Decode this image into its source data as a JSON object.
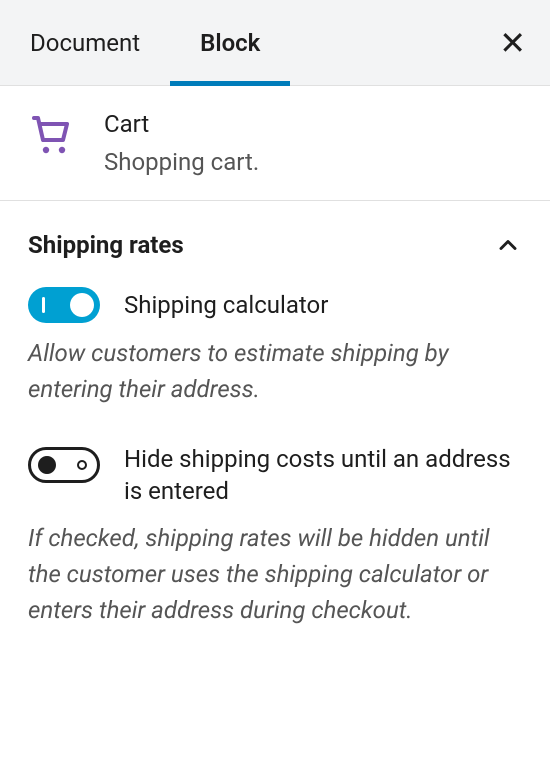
{
  "tabs": {
    "document": "Document",
    "block": "Block",
    "active": "block"
  },
  "block": {
    "title": "Cart",
    "description": "Shopping cart."
  },
  "panel": {
    "title": "Shipping rates",
    "expanded": true
  },
  "settings": {
    "calculator": {
      "label": "Shipping calculator",
      "enabled": true,
      "help": "Allow customers to estimate shipping by entering their address."
    },
    "hide_costs": {
      "label": "Hide shipping costs until an address is entered",
      "enabled": false,
      "help": "If checked, shipping rates will be hidden until the customer uses the shipping calculator or enters their address during checkout."
    }
  },
  "colors": {
    "accent": "#007cba",
    "toggle_on": "#00a0d2",
    "cart_icon": "#7f54b3"
  }
}
